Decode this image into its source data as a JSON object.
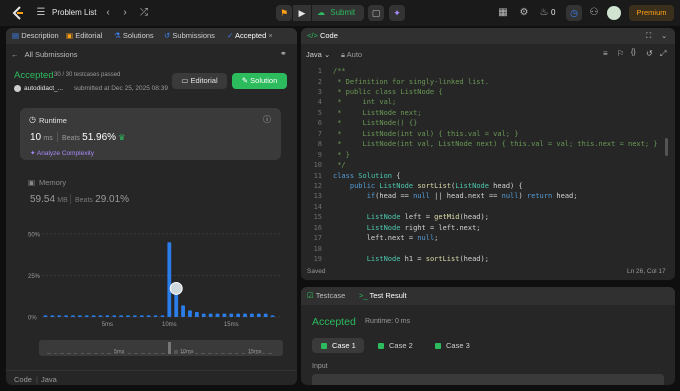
{
  "topbar": {
    "problem_list": "Problem List",
    "submit": "Submit",
    "streak": "0",
    "premium": "Premium"
  },
  "left": {
    "tabs": [
      "Description",
      "Editorial",
      "Solutions",
      "Submissions",
      "Accepted"
    ],
    "all_submissions": "All Submissions",
    "status": "Accepted",
    "testcases": "30 / 30 testcases passed",
    "username": "autodidact_...",
    "submitted_at": "submitted at Dec 25, 2025 08:39",
    "editorial_btn": "Editorial",
    "solution_btn": "Solution",
    "runtime_label": "Runtime",
    "runtime_value": "10",
    "runtime_unit": "ms",
    "beats_label": "Beats",
    "runtime_beats": "51.96%",
    "analyze": "Analyze Complexity",
    "memory_label": "Memory",
    "memory_value": "59.54",
    "memory_unit": "MB",
    "memory_beats": "29.01%",
    "y_ticks": [
      "50%",
      "25%",
      "0%"
    ],
    "x_ticks": [
      "5ms",
      "10ms",
      "15ms"
    ],
    "mini_ticks": [
      "5ms",
      "10ms",
      "15ms"
    ],
    "footer": [
      "Code",
      "Java"
    ]
  },
  "chart_data": {
    "type": "bar",
    "ylim": [
      0,
      50
    ],
    "ylabel": "",
    "xlabel": "",
    "x_ticks": [
      "5ms",
      "10ms",
      "15ms"
    ],
    "values": [
      1,
      1,
      1,
      1,
      1,
      1,
      1,
      1,
      1,
      1,
      1,
      1,
      1,
      1,
      1,
      1,
      1,
      1,
      45,
      16,
      7,
      4,
      3,
      2,
      2,
      2,
      2,
      2,
      2,
      2,
      2,
      2,
      2,
      1
    ],
    "highlight_index": 19
  },
  "editor": {
    "title": "Code",
    "language": "Java",
    "mode": "Auto",
    "status_saved": "Saved",
    "cursor": "Ln 26, Col 17",
    "line_numbers": [
      "1",
      "2",
      "3",
      "4",
      "5",
      "6",
      "7",
      "8",
      "9",
      "10",
      "11",
      "12",
      "13",
      "14",
      "15",
      "16",
      "17",
      "18",
      "19"
    ],
    "lines": [
      "/**",
      " * Definition for singly-linked list.",
      " * public class ListNode {",
      " *     int val;",
      " *     ListNode next;",
      " *     ListNode() {}",
      " *     ListNode(int val) { this.val = val; }",
      " *     ListNode(int val, ListNode next) { this.val = val; this.next = next; }",
      " * }",
      " */",
      "class Solution {",
      "    public ListNode sortList(ListNode head) {",
      "        if(head == null || head.next == null) return head;",
      "",
      "        ListNode left = getMid(head);",
      "        ListNode right = left.next;",
      "        left.next = null;",
      "",
      "        ListNode h1 = sortList(head);"
    ]
  },
  "bottom": {
    "tab_testcase": "Testcase",
    "tab_result": "Test Result",
    "accepted": "Accepted",
    "runtime": "Runtime: 0 ms",
    "cases": [
      "Case 1",
      "Case 2",
      "Case 3"
    ],
    "input_label": "Input"
  },
  "colors": {
    "accent_green": "#2cbb5d",
    "bar_blue": "#2b7de9",
    "premium": "#ffa116"
  }
}
